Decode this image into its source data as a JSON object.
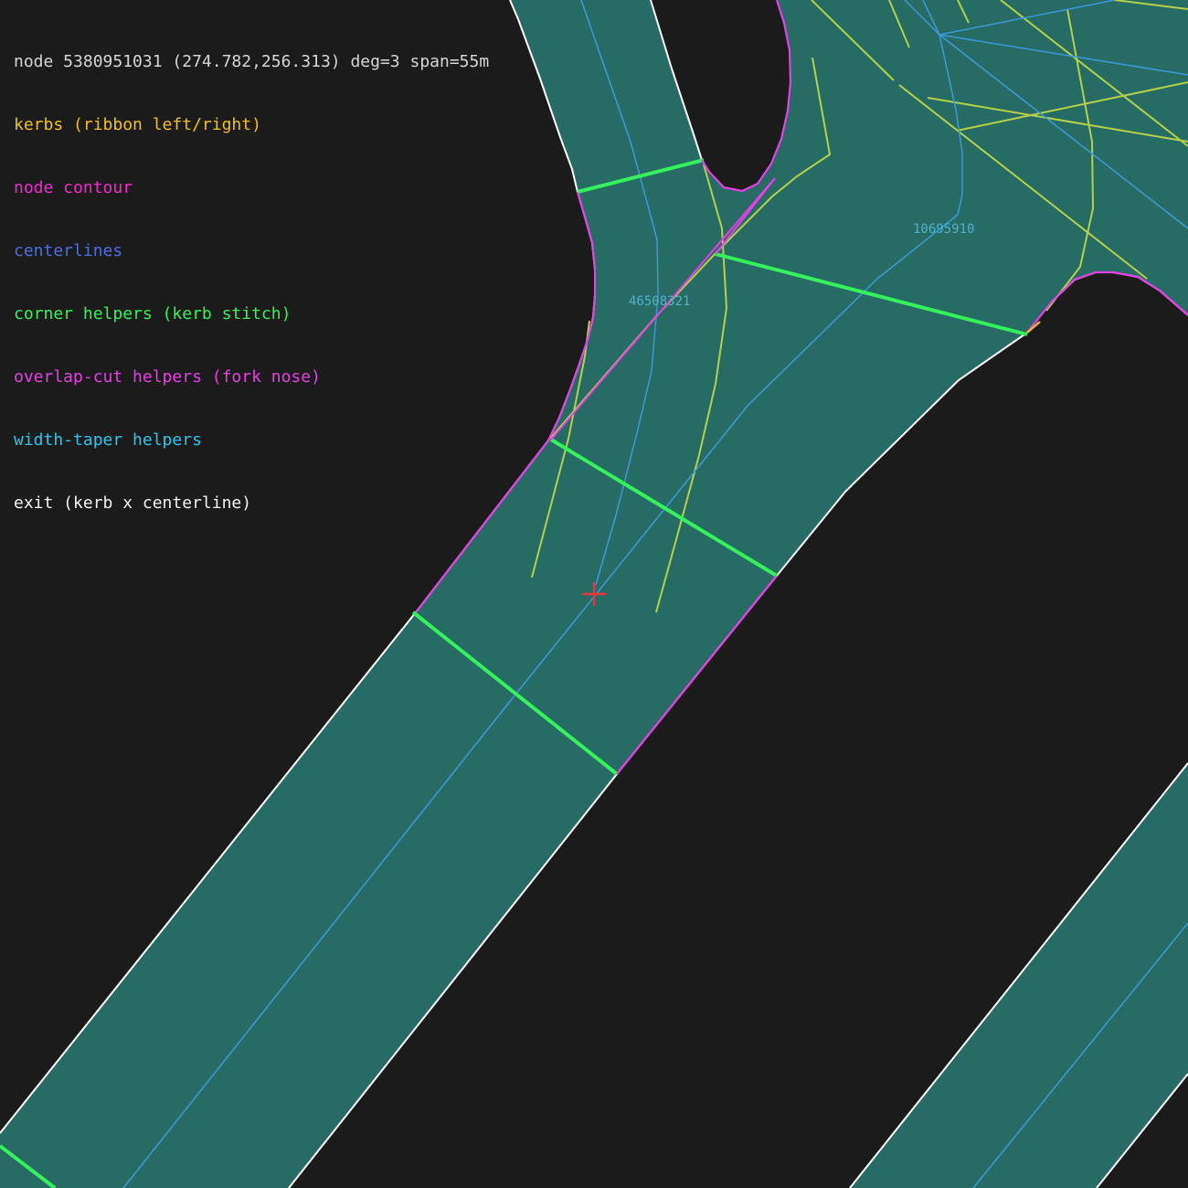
{
  "header": {
    "node_info": "node 5380951031 (274.782,256.313) deg=3 span=55m"
  },
  "legend": {
    "items": [
      {
        "key": "kerbs",
        "label": "kerbs (ribbon left/right)",
        "color": "#f2c01b"
      },
      {
        "key": "contour",
        "label": "node contour",
        "color": "#f02ccd"
      },
      {
        "key": "centerlines",
        "label": "centerlines",
        "color": "#4c6fde"
      },
      {
        "key": "corner",
        "label": "corner helpers (kerb stitch)",
        "color": "#35f25a"
      },
      {
        "key": "overlap",
        "label": "overlap-cut helpers (fork nose)",
        "color": "#e83ee6"
      },
      {
        "key": "taper",
        "label": "width-taper helpers",
        "color": "#2ec6e8"
      },
      {
        "key": "exit",
        "label": "exit (kerb x centerline)",
        "color": "#f2f2f2"
      }
    ]
  },
  "way_labels": {
    "way_a": "46508321",
    "way_b": "10695910"
  },
  "colors": {
    "background": "#1b1b1b",
    "road_fill": "#276b65",
    "kerb_outline": "#ffffff",
    "centerline": "#3a9ad8",
    "neighbor_line": "#b5d14a",
    "corner_helper": "#35f25a",
    "node_contour": "#e83ee6",
    "node_marker": "#e8333b",
    "way_label": "#4fb3cf"
  }
}
